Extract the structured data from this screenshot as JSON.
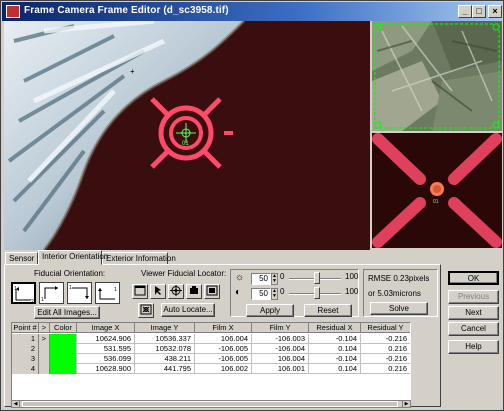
{
  "window": {
    "title": "Frame Camera Frame Editor (d_sc3958.tif)",
    "minimize": "_",
    "maximize": "□",
    "close": "×"
  },
  "viewer": {
    "fiducial_label": "01",
    "zoom_fiducial_label": "01"
  },
  "tabs": [
    {
      "label": "Sensor"
    },
    {
      "label": "Interior Orientation"
    },
    {
      "label": "Exterior Information"
    }
  ],
  "fiducial_orientation": {
    "label": "Fiducial Orientation:",
    "edit_all_label": "Edit All Images..."
  },
  "viewer_locator": {
    "label": "Viewer Fiducial Locator:",
    "auto_locate_label": "Auto Locate..."
  },
  "adjust": {
    "brightness_value": "50",
    "contrast_value": "50",
    "min_label": "0",
    "max_label": "100",
    "min_label2": "0",
    "max_label2": "100",
    "apply_label": "Apply",
    "reset_label": "Reset"
  },
  "rmse": {
    "pixels_text": "RMSE 0.23pixels",
    "microns_text": "or 5.03microns",
    "solve_label": "Solve"
  },
  "side_buttons": {
    "ok": "OK",
    "previous": "Previous",
    "next": "Next",
    "cancel": "Cancel",
    "help": "Help"
  },
  "table": {
    "headers": [
      "Point #",
      ">",
      "Color",
      "Image X",
      "Image Y",
      "Film X",
      "Film Y",
      "Residual X",
      "Residual Y"
    ],
    "rows": [
      {
        "point": "1",
        "marker": ">",
        "color": "#00ff00",
        "image_x": "10624.906",
        "image_y": "10536.337",
        "film_x": "106.004",
        "film_y": "-106.003",
        "residual_x": "-0.104",
        "residual_y": "-0.216"
      },
      {
        "point": "2",
        "marker": "",
        "color": "#00ff00",
        "image_x": "531.595",
        "image_y": "10532.078",
        "film_x": "-106.005",
        "film_y": "-106.004",
        "residual_x": "0.104",
        "residual_y": "0.216"
      },
      {
        "point": "3",
        "marker": "",
        "color": "#00ff00",
        "image_x": "536.099",
        "image_y": "438.211",
        "film_x": "-106.005",
        "film_y": "106.004",
        "residual_x": "-0.104",
        "residual_y": "-0.216"
      },
      {
        "point": "4",
        "marker": "",
        "color": "#00ff00",
        "image_x": "10628.900",
        "image_y": "441.795",
        "film_x": "106.002",
        "film_y": "106.001",
        "residual_x": "0.104",
        "residual_y": "0.216"
      }
    ]
  }
}
